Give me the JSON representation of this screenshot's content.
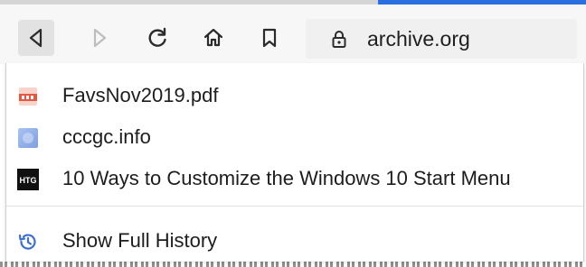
{
  "toolbar": {
    "buttons": [
      {
        "name": "back",
        "icon": "back-arrow-icon",
        "active": true,
        "enabled": true
      },
      {
        "name": "forward",
        "icon": "forward-arrow-icon",
        "enabled": false
      },
      {
        "name": "refresh",
        "icon": "refresh-icon",
        "enabled": true
      },
      {
        "name": "home",
        "icon": "home-icon",
        "enabled": true
      },
      {
        "name": "bookmark",
        "icon": "bookmark-icon",
        "enabled": true
      }
    ],
    "address": {
      "url": "archive.org",
      "icon": "lock-icon"
    }
  },
  "history_menu": {
    "items": [
      {
        "label": "FavsNov2019.pdf",
        "icon": "pdf-file-icon"
      },
      {
        "label": "cccgc.info",
        "icon": "site-favicon-icon"
      },
      {
        "label": "10 Ways to Customize the Windows 10 Start Menu",
        "icon": "htg-favicon-icon",
        "icon_text": "HTG"
      }
    ],
    "footer": {
      "label": "Show Full History",
      "icon": "history-icon"
    }
  },
  "colors": {
    "accent": "#2a6fe0",
    "icon": "#2b2b2b",
    "disabled_icon": "#bdbdbd",
    "history_icon": "#3b6fd6"
  }
}
